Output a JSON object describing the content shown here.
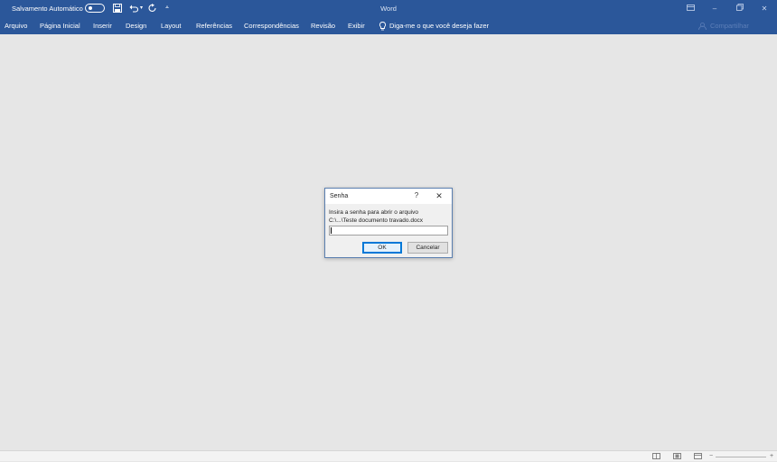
{
  "titlebar": {
    "autosave_label": "Salvamento Automático",
    "autosave_state": "off",
    "app_title": "Word",
    "quick_access": [
      "save-icon",
      "undo-icon",
      "redo-icon",
      "customize-icon"
    ],
    "window_controls": [
      "ribbon-display-icon",
      "minimize-icon",
      "restore-icon",
      "close-icon"
    ]
  },
  "ribbon": {
    "tabs": [
      "Arquivo",
      "Página Inicial",
      "Inserir",
      "Design",
      "Layout",
      "Referências",
      "Correspondências",
      "Revisão",
      "Exibir"
    ],
    "tell_me": "Diga-me o que você deseja fazer",
    "share": "Compartilhar"
  },
  "dialog": {
    "title": "Senha",
    "help_glyph": "?",
    "close_glyph": "✕",
    "message_line1": "Insira a senha para abrir o arquivo",
    "message_line2": "C:\\...\\Teste documento travado.docx",
    "password_value": "",
    "ok_label": "OK",
    "cancel_label": "Cancelar"
  },
  "statusbar": {
    "view_icons": [
      "read-mode-icon",
      "print-layout-icon",
      "web-layout-icon"
    ],
    "zoom_out_glyph": "−",
    "zoom_in_glyph": "+"
  },
  "colors": {
    "ribbon_blue": "#2b579a",
    "workspace": "#e6e6e6",
    "dialog_border": "#5b7fb0",
    "focus_blue": "#0078d7"
  }
}
